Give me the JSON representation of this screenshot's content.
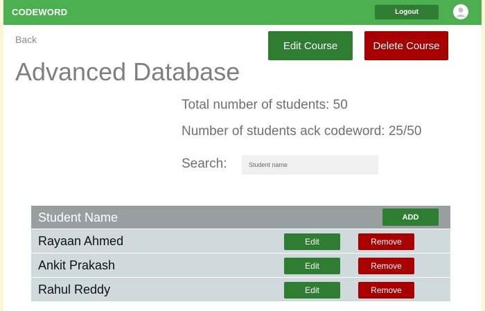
{
  "header": {
    "brand": "CODEWORD",
    "logout_label": "Logout",
    "avatar_icon": "user-avatar-icon",
    "color": "#4caf50"
  },
  "page": {
    "back_label": "Back",
    "edit_course_label": "Edit Course",
    "delete_course_label": "Delete Course",
    "title": "Advanced Database",
    "total_students_text": "Total number of students: 50",
    "ack_students_text": "Number of students ack codeword: 25/50",
    "search_label": "Search:",
    "search_placeholder": "Student name",
    "search_value": ""
  },
  "table": {
    "header_label": "Student Name",
    "add_label": "ADD",
    "rows": [
      {
        "name": "Rayaan Ahmed",
        "edit_label": "Edit",
        "remove_label": "Remove"
      },
      {
        "name": "Ankit Prakash",
        "edit_label": "Edit",
        "remove_label": "Remove"
      },
      {
        "name": "Rahul Reddy",
        "edit_label": "Edit",
        "remove_label": "Remove"
      }
    ]
  },
  "colors": {
    "primary_green": "#2e7d32",
    "danger_red": "#a80000",
    "table_header": "#979fa0",
    "table_row": "#d0d9dc"
  }
}
